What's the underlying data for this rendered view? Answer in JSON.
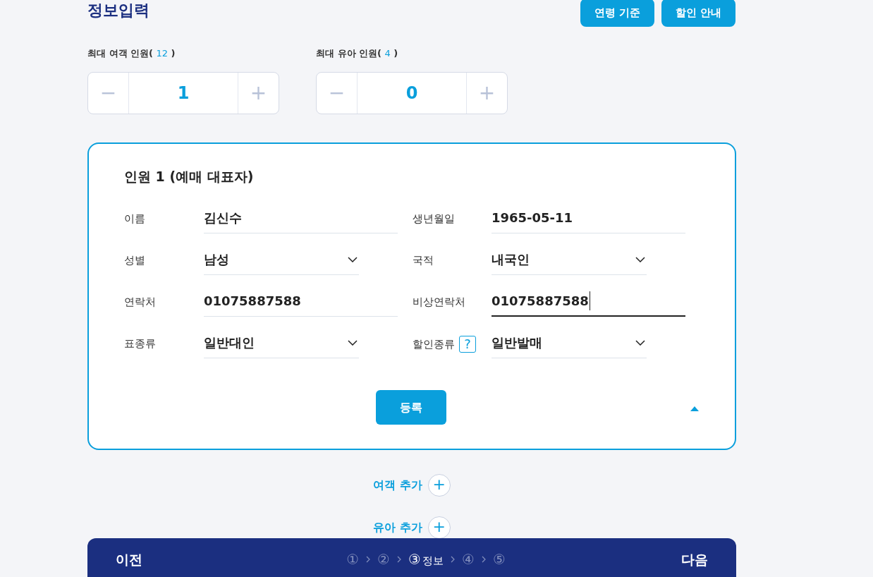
{
  "section_title": "정보입력",
  "header_buttons": [
    "연령 기준",
    "할인 안내"
  ],
  "counters": [
    {
      "label": "최대 여객 인원(",
      "max": "12",
      "close": ")",
      "value": "1",
      "minus": "−",
      "plus": "+"
    },
    {
      "label": "최대 유아 인원(",
      "max": "4",
      "close": ")",
      "value": "0",
      "minus": "−",
      "plus": "+"
    }
  ],
  "person_card": {
    "title": "인원 1 (예매 대표자)",
    "expanded": true,
    "fields": [
      {
        "label": "이름",
        "value": "김신수",
        "kind": "text",
        "focused": false
      },
      {
        "label": "생년월일",
        "value": "1965-05-11",
        "kind": "text",
        "focused": false
      },
      {
        "label": "성별",
        "value": "남성",
        "kind": "select",
        "focused": false
      },
      {
        "label": "국적",
        "value": "내국인",
        "kind": "select",
        "focused": false
      },
      {
        "label": "연락처",
        "value": "01075887588",
        "kind": "text",
        "focused": false
      },
      {
        "label": "비상연락처",
        "value": "01075887588",
        "kind": "text",
        "focused": true
      },
      {
        "label": "표종류",
        "value": "일반대인",
        "kind": "select",
        "focused": false
      },
      {
        "label": "할인종류",
        "help": "?",
        "value": "일반발매",
        "kind": "select",
        "focused": false
      }
    ],
    "submit": "등록"
  },
  "add_links": [
    {
      "label": "여객 추가",
      "icon": "+"
    },
    {
      "label": "유아 추가",
      "icon": "+"
    }
  ],
  "footer": {
    "prev": "이전",
    "next": "다음",
    "steps": [
      {
        "number": "①",
        "selected": false
      },
      {
        "number": "②",
        "selected": false
      },
      {
        "number": "③",
        "label": "정보",
        "selected": true
      },
      {
        "number": "④",
        "selected": false
      },
      {
        "number": "⑤",
        "selected": false
      }
    ]
  }
}
